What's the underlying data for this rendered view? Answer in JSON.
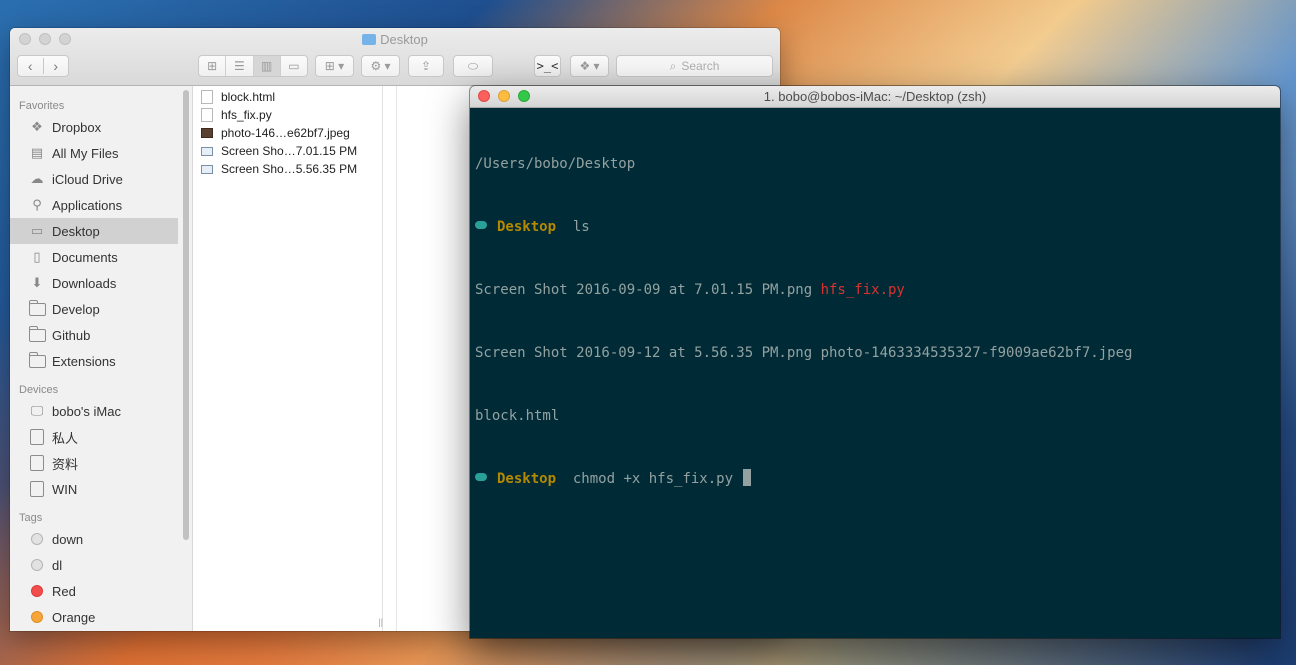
{
  "finder": {
    "title": "Desktop",
    "search_placeholder": "Search",
    "sidebar": {
      "favorites_label": "Favorites",
      "favorites": [
        "Dropbox",
        "All My Files",
        "iCloud Drive",
        "Applications",
        "Desktop",
        "Documents",
        "Downloads",
        "Develop",
        "Github",
        "Extensions"
      ],
      "devices_label": "Devices",
      "devices": [
        "bobo's iMac",
        "私人",
        "资料",
        "WIN"
      ],
      "tags_label": "Tags",
      "tags": [
        "down",
        "dl",
        "Red",
        "Orange"
      ]
    },
    "files": [
      "block.html",
      "hfs_fix.py",
      "photo-146…e62bf7.jpeg",
      "Screen Sho…7.01.15 PM",
      "Screen Sho…5.56.35 PM"
    ]
  },
  "terminal": {
    "title": "1. bobo@bobos-iMac: ~/Desktop (zsh)",
    "lines": {
      "pwd": "/Users/bobo/Desktop",
      "prompt_dir": "Desktop",
      "cmd1": "ls",
      "ls1_a": "Screen Shot 2016-09-09 at 7.01.15 PM.png ",
      "ls1_b": "hfs_fix.py",
      "ls2": "Screen Shot 2016-09-12 at 5.56.35 PM.png photo-1463334535327-f9009ae62bf7.jpeg",
      "ls3": "block.html",
      "cmd2": "chmod +x hfs_fix.py "
    }
  }
}
